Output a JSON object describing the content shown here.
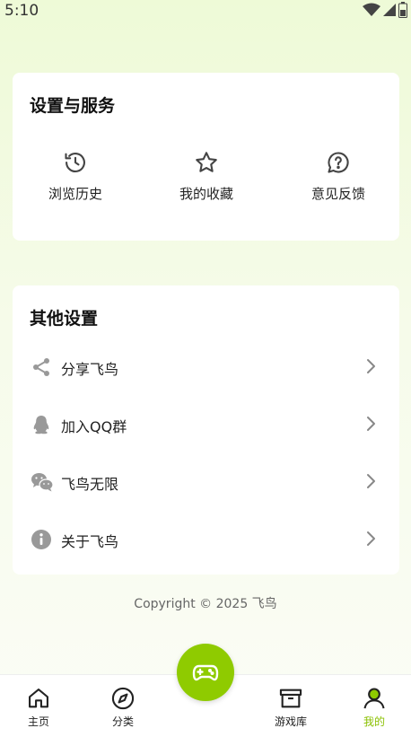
{
  "status_bar": {
    "time": "5:10",
    "icons": [
      "wifi-icon",
      "signal-icon",
      "battery-icon"
    ]
  },
  "settings_card": {
    "title": "设置与服务",
    "items": [
      {
        "label": "浏览历史",
        "icon": "history-icon"
      },
      {
        "label": "我的收藏",
        "icon": "star-icon"
      },
      {
        "label": "意见反馈",
        "icon": "feedback-icon"
      }
    ]
  },
  "other_card": {
    "title": "其他设置",
    "items": [
      {
        "label": "分享飞鸟",
        "icon": "share-icon"
      },
      {
        "label": "加入QQ群",
        "icon": "qq-icon"
      },
      {
        "label": "飞鸟无限",
        "icon": "wechat-icon"
      },
      {
        "label": "关于飞鸟",
        "icon": "info-icon"
      }
    ]
  },
  "copyright": "Copyright © 2025 飞鸟",
  "tabbar": {
    "items": [
      {
        "label": "主页",
        "icon": "home-icon"
      },
      {
        "label": "分类",
        "icon": "compass-icon"
      },
      {
        "label": "游戏库",
        "icon": "archive-icon"
      },
      {
        "label": "我的",
        "icon": "user-icon",
        "active": true
      }
    ],
    "fab_icon": "gamepad-icon"
  },
  "colors": {
    "accent": "#8fcb00",
    "active_tab": "#8ac000"
  }
}
